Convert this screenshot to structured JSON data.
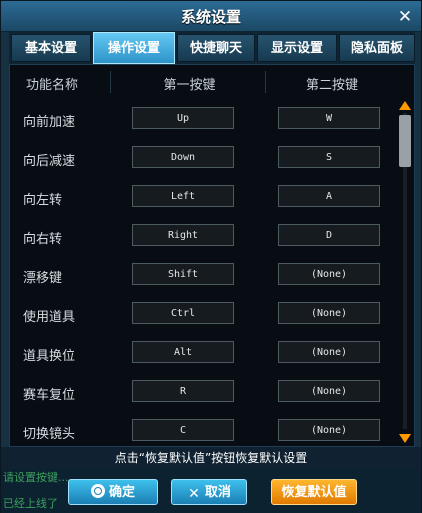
{
  "window": {
    "title": "系统设置",
    "close_glyph": "✕"
  },
  "tabs": [
    {
      "label": "基本设置",
      "active": false
    },
    {
      "label": "操作设置",
      "active": true
    },
    {
      "label": "快捷聊天",
      "active": false
    },
    {
      "label": "显示设置",
      "active": false
    },
    {
      "label": "隐私面板",
      "active": false
    }
  ],
  "table": {
    "headers": [
      "功能名称",
      "第一按键",
      "第二按键"
    ],
    "rows": [
      {
        "label": "向前加速",
        "key1": "Up",
        "key2": "W"
      },
      {
        "label": "向后减速",
        "key1": "Down",
        "key2": "S"
      },
      {
        "label": "向左转",
        "key1": "Left",
        "key2": "A"
      },
      {
        "label": "向右转",
        "key1": "Right",
        "key2": "D"
      },
      {
        "label": "漂移键",
        "key1": "Shift",
        "key2": "(None)"
      },
      {
        "label": "使用道具",
        "key1": "Ctrl",
        "key2": "(None)"
      },
      {
        "label": "道具换位",
        "key1": "Alt",
        "key2": "(None)"
      },
      {
        "label": "赛车复位",
        "key1": "R",
        "key2": "(None)"
      },
      {
        "label": "切换镜头",
        "key1": "C",
        "key2": "(None)"
      }
    ]
  },
  "hint": "点击“恢复默认值”按钮恢复默认设置",
  "buttons": {
    "ok": "确定",
    "cancel": "取消",
    "reset": "恢复默认值"
  },
  "background_chat": [
    "请设置按键...",
    "已经上线了"
  ],
  "colors": {
    "accent": "#2e93c8",
    "highlight": "#ff9a00",
    "panel_bg": "#070d12"
  },
  "icons": {
    "ok": "circle-icon",
    "cancel": "x-icon",
    "scroll_up": "arrow-up-icon",
    "scroll_down": "arrow-down-icon"
  }
}
